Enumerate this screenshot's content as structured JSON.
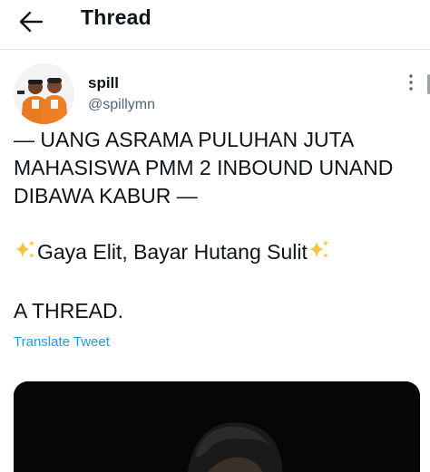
{
  "header": {
    "back_icon": "arrow-left-icon",
    "title": "Thread"
  },
  "tweet": {
    "author": {
      "name": "spill",
      "handle": "@spillymn"
    },
    "more_icon": "more-vertical-icon",
    "text": {
      "line1": "— UANG ASRAMA PULUHAN JUTA",
      "line2": "MAHASISWA PMM 2 INBOUND UNAND",
      "line3": "DIBAWA KABUR —",
      "line4_text": "Gaya Elit, Bayar Hutang Sulit",
      "line4_emoji": "sparkles-emoji",
      "line5": "A THREAD."
    },
    "translate_label": "Translate Tweet",
    "media": {
      "kind": "photo",
      "dominant_color": "#060606"
    }
  },
  "colors": {
    "text": "#0f1419",
    "secondary": "#536471",
    "link": "#1d9bf0",
    "divider": "#e3e6e8",
    "sparkle": "#f7c33c"
  }
}
